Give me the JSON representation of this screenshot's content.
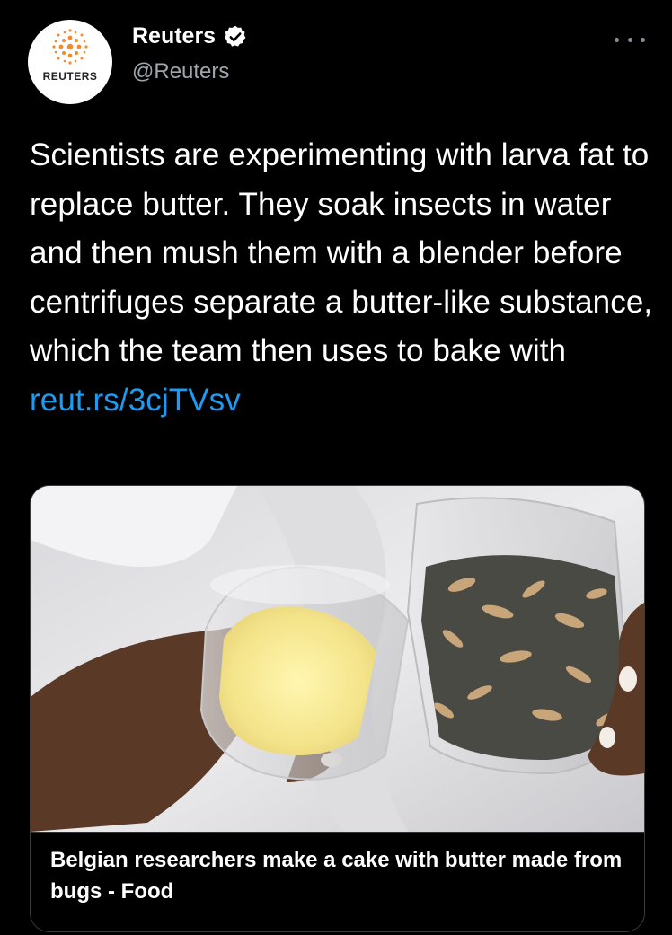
{
  "tweet": {
    "author_name": "Reuters",
    "author_handle": "@Reuters",
    "avatar_label": "REUTERS",
    "verified_icon": "verified-badge-icon",
    "more_icon": "more-options-icon",
    "text": "Scientists are experimenting with larva fat to replace butter. They soak insects in water and then mush them with a blender before centrifuges separate a butter-like substance, which the team then uses to bake with ",
    "link_text": "reut.rs/3cjTVsv"
  },
  "card": {
    "title": "Belgian researchers make a cake with butter made from bugs - Food"
  },
  "colors": {
    "background": "#000000",
    "text": "#ffffff",
    "secondary_text": "#a0a6ad",
    "link": "#1d9bf0",
    "verified": "#ffffff",
    "reuters_orange": "#f28c28"
  }
}
